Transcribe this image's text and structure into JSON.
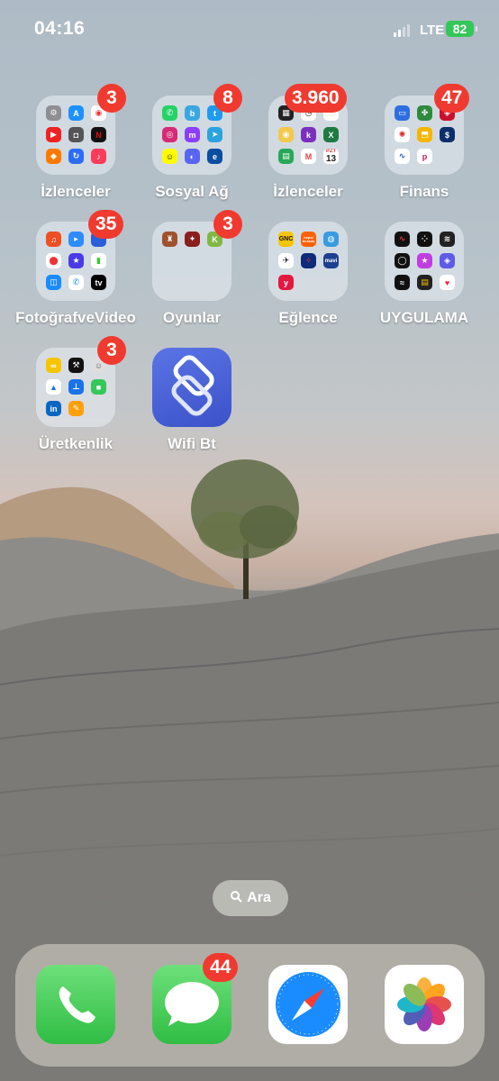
{
  "status_bar": {
    "time": "04:16",
    "network": "LTE",
    "battery": "82"
  },
  "apps": [
    {
      "label": "İzlenceler",
      "badge": "3",
      "icon": "folder-icon"
    },
    {
      "label": "Sosyal Ağ",
      "badge": "8",
      "icon": "folder-icon"
    },
    {
      "label": "İzlenceler",
      "badge": "3.960",
      "icon": "folder-icon"
    },
    {
      "label": "Finans",
      "badge": "47",
      "icon": "folder-icon"
    },
    {
      "label": "FotoğrafveVideo",
      "badge": "35",
      "icon": "folder-icon"
    },
    {
      "label": "Oyunlar",
      "badge": "3",
      "icon": "folder-icon"
    },
    {
      "label": "Eğlence",
      "badge": "",
      "icon": "folder-icon"
    },
    {
      "label": "UYGULAMA",
      "badge": "",
      "icon": "folder-icon"
    },
    {
      "label": "Üretkenlik",
      "badge": "3",
      "icon": "folder-icon"
    },
    {
      "label": "Wifi Bt",
      "badge": "",
      "icon": "shortcuts-icon"
    }
  ],
  "folder_mini_texts": {
    "gnc": "GNC",
    "hepsi": "hepsi burada",
    "mavi": "mavi",
    "tv": "tv",
    "cal_day": "13",
    "cal_month": "PZT"
  },
  "search": {
    "label": "Ara"
  },
  "dock": [
    {
      "name": "Phone",
      "icon": "phone-icon",
      "badge": ""
    },
    {
      "name": "Messages",
      "icon": "messages-icon",
      "badge": "44"
    },
    {
      "name": "Safari",
      "icon": "safari-icon",
      "badge": ""
    },
    {
      "name": "Photos",
      "icon": "photos-icon",
      "badge": ""
    }
  ],
  "colors": {
    "badge": "#f03a2f",
    "battery": "#34c759",
    "phone": "#34c759",
    "messages": "#34c759",
    "shortcuts": "#4a63d8"
  }
}
